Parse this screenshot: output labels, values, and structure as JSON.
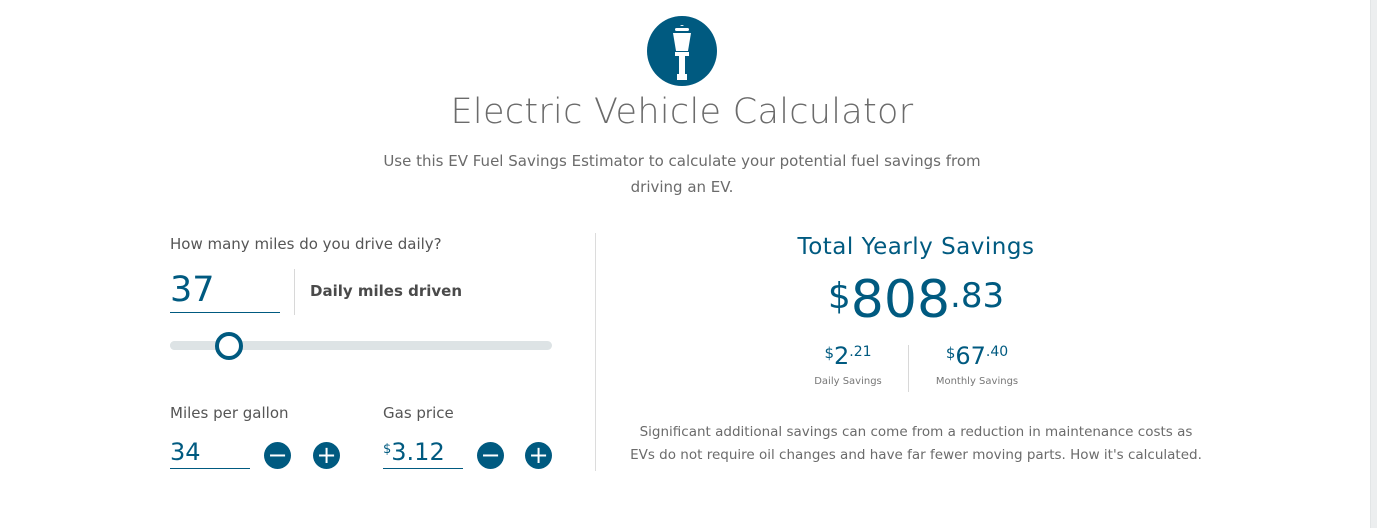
{
  "header": {
    "logo_icon": "street-lamp-icon",
    "title": "Electric Vehicle Calculator",
    "subtitle": "Use this EV Fuel Savings Estimator to calculate your potential fuel savings from driving an EV."
  },
  "daily_miles": {
    "question": "How many miles do you drive daily?",
    "value": "37",
    "unit_label": "Daily miles driven",
    "slider_level": 0.155
  },
  "mpg": {
    "label": "Miles per gallon",
    "value": "34"
  },
  "gas_price": {
    "label": "Gas price",
    "currency": "$",
    "value": "3.12"
  },
  "buttons": {
    "minus_icon": "minus-icon",
    "plus_icon": "plus-icon",
    "minus": "−",
    "plus": "+"
  },
  "results": {
    "title": "Total Yearly Savings",
    "total": {
      "currency": "$",
      "whole": "808",
      "cents": ".83"
    },
    "daily": {
      "currency": "$",
      "whole": "2",
      "cents": ".21",
      "label": "Daily Savings"
    },
    "monthly": {
      "currency": "$",
      "whole": "67",
      "cents": ".40",
      "label": "Monthly Savings"
    },
    "note": "Significant additional savings can come from a reduction in maintenance costs as EVs do not require oil changes and have far fewer moving parts.",
    "note_link": "How it's calculated."
  },
  "colors": {
    "accent": "#005a80",
    "text": "#6b6b6b",
    "track": "#dde3e5"
  }
}
